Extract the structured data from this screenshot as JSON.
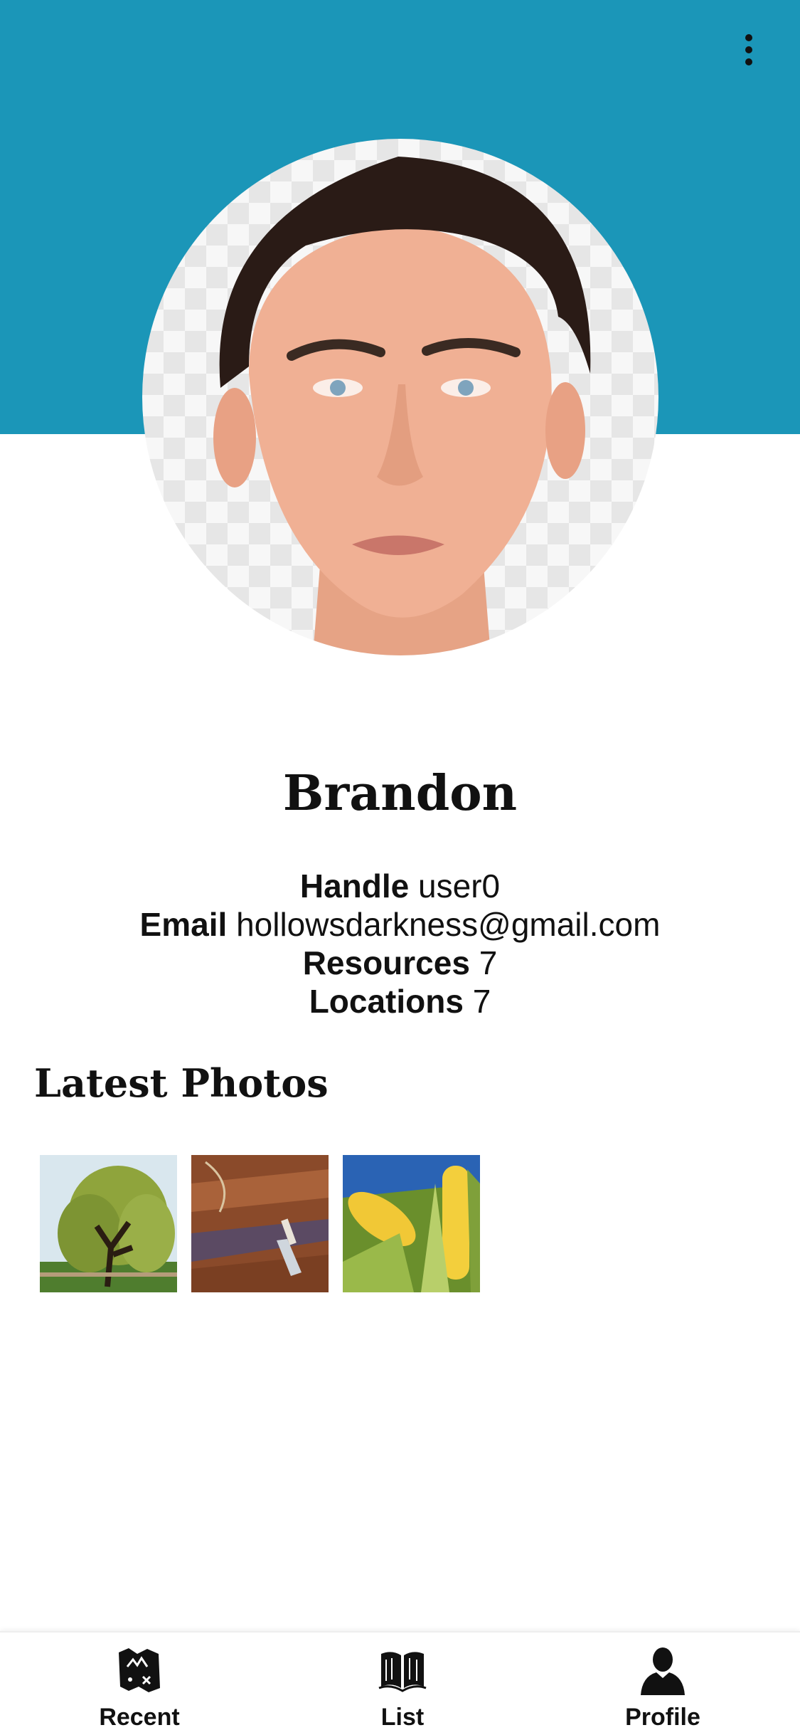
{
  "header": {
    "bg_color": "#1b96b8",
    "menu_icon": "more-vert-icon"
  },
  "profile": {
    "avatar_icon": "profile-photo-face",
    "name": "Brandon",
    "fields": [
      {
        "label": "Handle",
        "value": "user0"
      },
      {
        "label": "Email",
        "value": "hollowsdarkness@gmail.com"
      },
      {
        "label": "Resources",
        "value": "7"
      },
      {
        "label": "Locations",
        "value": "7"
      }
    ]
  },
  "latest_photos": {
    "title": "Latest Photos",
    "items": [
      "willow-tree-photo",
      "dug-soil-trowel-photo",
      "corn-cobs-photo"
    ]
  },
  "tabbar": {
    "tabs": [
      {
        "label": "Recent",
        "icon": "treasure-map-icon"
      },
      {
        "label": "List",
        "icon": "open-book-icon"
      },
      {
        "label": "Profile",
        "icon": "person-silhouette-icon"
      }
    ],
    "active": "Profile"
  }
}
